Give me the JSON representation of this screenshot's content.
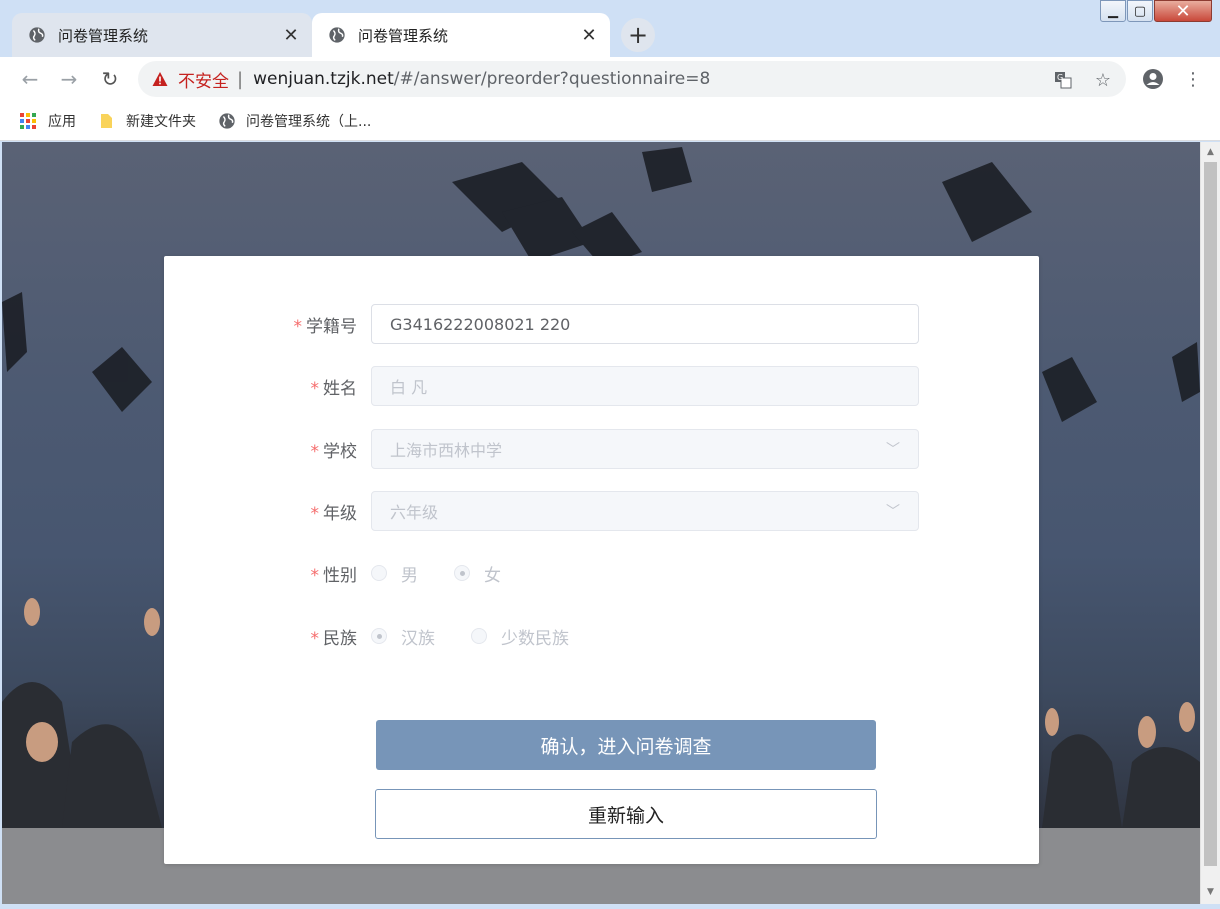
{
  "browser": {
    "tabs": [
      {
        "title": "问卷管理系统",
        "active": false
      },
      {
        "title": "问卷管理系统",
        "active": true
      }
    ],
    "security_label": "不安全",
    "url_host": "wenjuan.tzjk.net",
    "url_path": "/#/answer/preorder?questionnaire=8",
    "bookmarks": [
      {
        "label": "应用",
        "icon": "apps-grid-icon"
      },
      {
        "label": "新建文件夹",
        "icon": "folder-icon"
      },
      {
        "label": "问卷管理系统（上...",
        "icon": "globe-icon"
      }
    ]
  },
  "form": {
    "student_id": {
      "label": "学籍号",
      "value": "G3416222008021  220"
    },
    "name": {
      "label": "姓名",
      "value": "白  凡"
    },
    "school": {
      "label": "学校",
      "value": "上海市西林中学"
    },
    "grade": {
      "label": "年级",
      "value": "六年级"
    },
    "gender": {
      "label": "性别",
      "options": [
        "男",
        "女"
      ],
      "selected": "女"
    },
    "ethnicity": {
      "label": "民族",
      "options": [
        "汉族",
        "少数民族"
      ],
      "selected": "汉族"
    },
    "required_mark": "*",
    "confirm_label": "确认，进入问卷调查",
    "reset_label": "重新输入"
  },
  "colors": {
    "primary_button": "#7795b8",
    "required_star": "#f56c6c",
    "insecure_text": "#c5221f"
  }
}
